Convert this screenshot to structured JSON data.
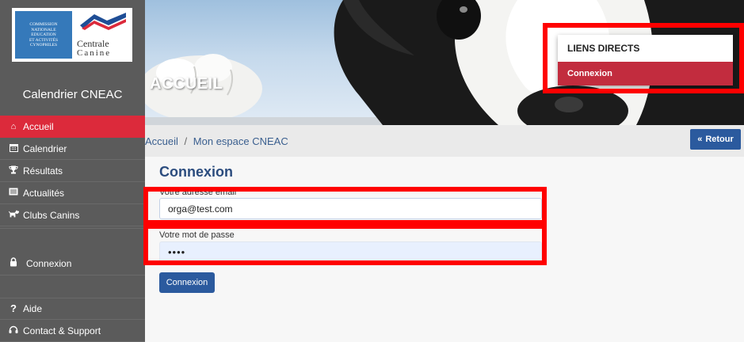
{
  "logo": {
    "left_lines": [
      "Commission",
      "Nationale",
      "Education",
      "et Activités",
      "Cynophiles"
    ],
    "right_line1": "Centrale",
    "right_line2": "Canine"
  },
  "sidebar": {
    "title": "Calendrier CNEAC",
    "items": [
      {
        "label": "Accueil",
        "icon": "home-icon",
        "active": true
      },
      {
        "label": "Calendrier",
        "icon": "calendar-icon"
      },
      {
        "label": "Résultats",
        "icon": "trophy-icon"
      },
      {
        "label": "Actualités",
        "icon": "newspaper-icon"
      },
      {
        "label": "Clubs Canins",
        "icon": "dog-icon"
      },
      {
        "label": "Connexion",
        "icon": "lock-icon"
      },
      {
        "label": "Aide",
        "icon": "question-icon"
      },
      {
        "label": "Contact & Support",
        "icon": "headset-icon"
      }
    ]
  },
  "banner": {
    "heading": "ACCUEIL",
    "direct_links": {
      "title": "LIENS DIRECTS",
      "connexion_label": "Connexion"
    }
  },
  "breadcrumb": {
    "home": "Accueil",
    "separator": "/",
    "current": "Mon espace CNEAC",
    "back_label": "Retour"
  },
  "form": {
    "title": "Connexion",
    "email_label": "Votre adresse email",
    "email_value": "orga@test.com",
    "password_label": "Votre mot de passe",
    "password_value": "••••",
    "submit_label": "Connexion"
  },
  "colors": {
    "accent_red": "#dc2a3b",
    "primary_blue": "#2b5a9e",
    "sidebar_bg": "#5b5b5b",
    "highlight": "#ff0000"
  }
}
